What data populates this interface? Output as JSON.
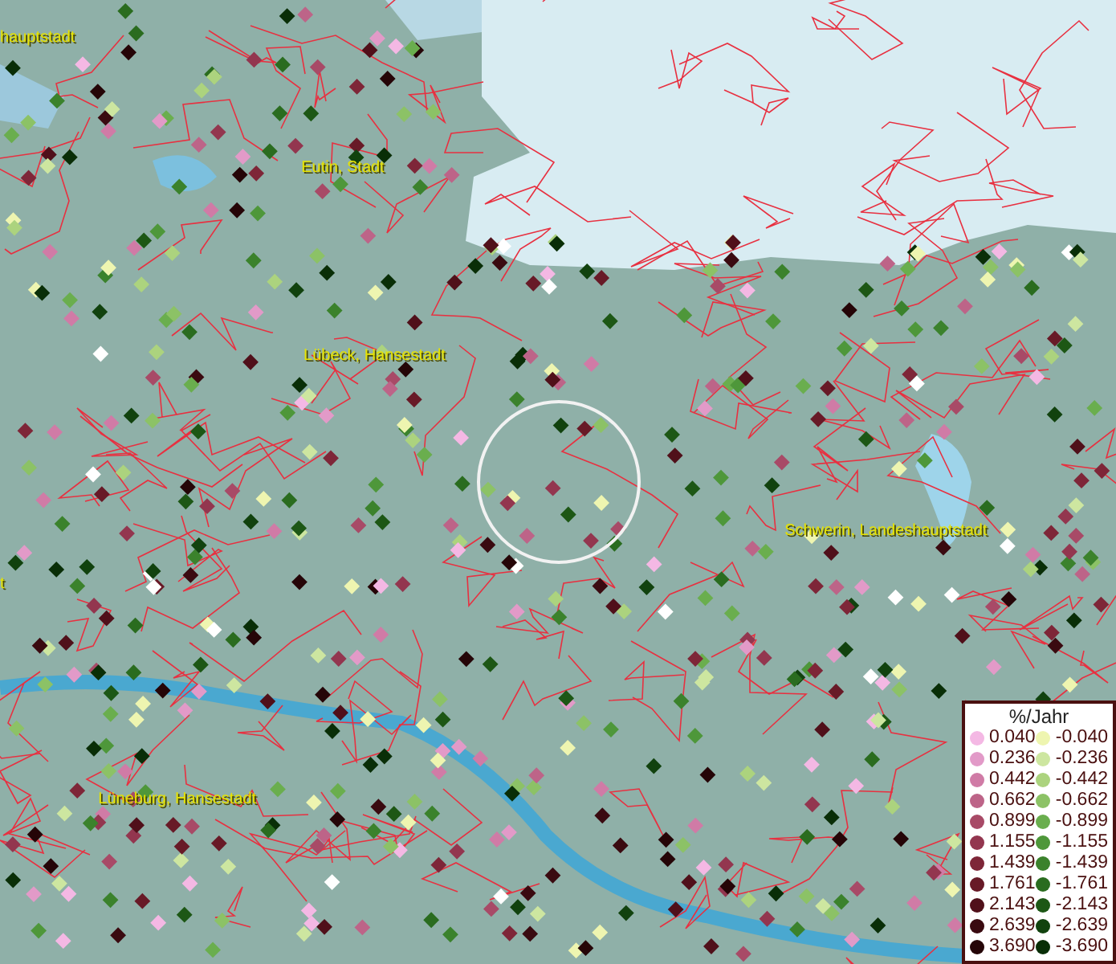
{
  "map": {
    "place_labels": [
      {
        "text": "hauptstadt"
      },
      {
        "text": "Eutin, Stadt"
      },
      {
        "text": "Lübeck, Hansestadt"
      },
      {
        "text": "Schwerin, Landeshauptstadt"
      },
      {
        "text": "t"
      },
      {
        "text": "Lüneburg, Hansestadt"
      }
    ]
  },
  "legend": {
    "title": "%/Jahr",
    "columns": [
      {
        "items": [
          {
            "label": "0.040",
            "color": "#f4b8e4"
          },
          {
            "label": "0.236",
            "color": "#e29ac8"
          },
          {
            "label": "0.442",
            "color": "#d07ba6"
          },
          {
            "label": "0.662",
            "color": "#bd6488"
          },
          {
            "label": "0.899",
            "color": "#a84a67"
          },
          {
            "label": "1.155",
            "color": "#93364f"
          },
          {
            "label": "1.439",
            "color": "#7e2638"
          },
          {
            "label": "1.761",
            "color": "#681a27"
          },
          {
            "label": "2.143",
            "color": "#50101a"
          },
          {
            "label": "2.639",
            "color": "#3a0a10"
          },
          {
            "label": "3.690",
            "color": "#250507"
          }
        ]
      },
      {
        "items": [
          {
            "label": "-0.040",
            "color": "#eef5b0"
          },
          {
            "label": "-0.236",
            "color": "#cde6a0"
          },
          {
            "label": "-0.442",
            "color": "#acd37e"
          },
          {
            "label": "-0.662",
            "color": "#8cc266"
          },
          {
            "label": "-0.899",
            "color": "#6aae4e"
          },
          {
            "label": "-1.155",
            "color": "#4e973a"
          },
          {
            "label": "-1.439",
            "color": "#3b822c"
          },
          {
            "label": "-1.761",
            "color": "#2a6c1f"
          },
          {
            "label": "-2.143",
            "color": "#1d5715"
          },
          {
            "label": "-2.639",
            "color": "#11420e"
          },
          {
            "label": "-3.690",
            "color": "#092e07"
          }
        ]
      }
    ]
  }
}
